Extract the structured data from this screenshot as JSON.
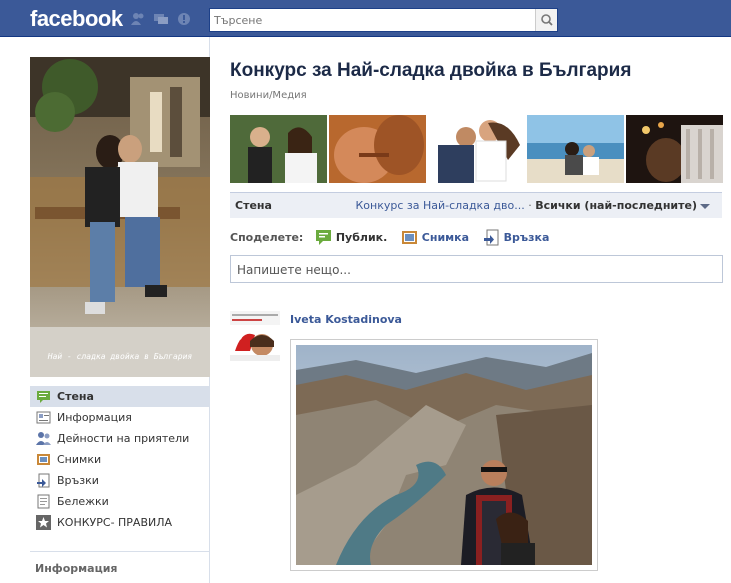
{
  "topbar": {
    "logo": "facebook",
    "search": {
      "placeholder": "Търсене"
    }
  },
  "page": {
    "title": "Конкурс за Най-сладка двойка в България",
    "category": "Новини/Медия",
    "profile_caption": "Най - сладка двойка в България"
  },
  "sidebar": {
    "items": [
      {
        "label": "Стена",
        "icon": "wall-icon",
        "active": true
      },
      {
        "label": "Информация",
        "icon": "info-icon"
      },
      {
        "label": "Дейности на приятели",
        "icon": "friends-icon"
      },
      {
        "label": "Снимки",
        "icon": "photos-icon"
      },
      {
        "label": "Връзки",
        "icon": "links-icon"
      },
      {
        "label": "Бележки",
        "icon": "notes-icon"
      },
      {
        "label": "КОНКУРС- ПРАВИЛА",
        "icon": "star-icon"
      }
    ],
    "info_heading": "Информация"
  },
  "wall": {
    "tab": "Стена",
    "page_link": "Конкурс за Най-сладка дво...",
    "separator": " · ",
    "filter": "Всички (най-последните)"
  },
  "share": {
    "label": "Споделете:",
    "options": [
      {
        "label": "Публик.",
        "icon": "status-icon"
      },
      {
        "label": "Снимка",
        "icon": "photo-icon"
      },
      {
        "label": "Връзка",
        "icon": "link-icon"
      }
    ]
  },
  "composer": {
    "placeholder": "Напишете нещо..."
  },
  "post": {
    "author": "Iveta Kostadinova"
  },
  "colors": {
    "brand": "#3b5998",
    "link": "#3b5998",
    "nav_active": "#d8dfea"
  }
}
